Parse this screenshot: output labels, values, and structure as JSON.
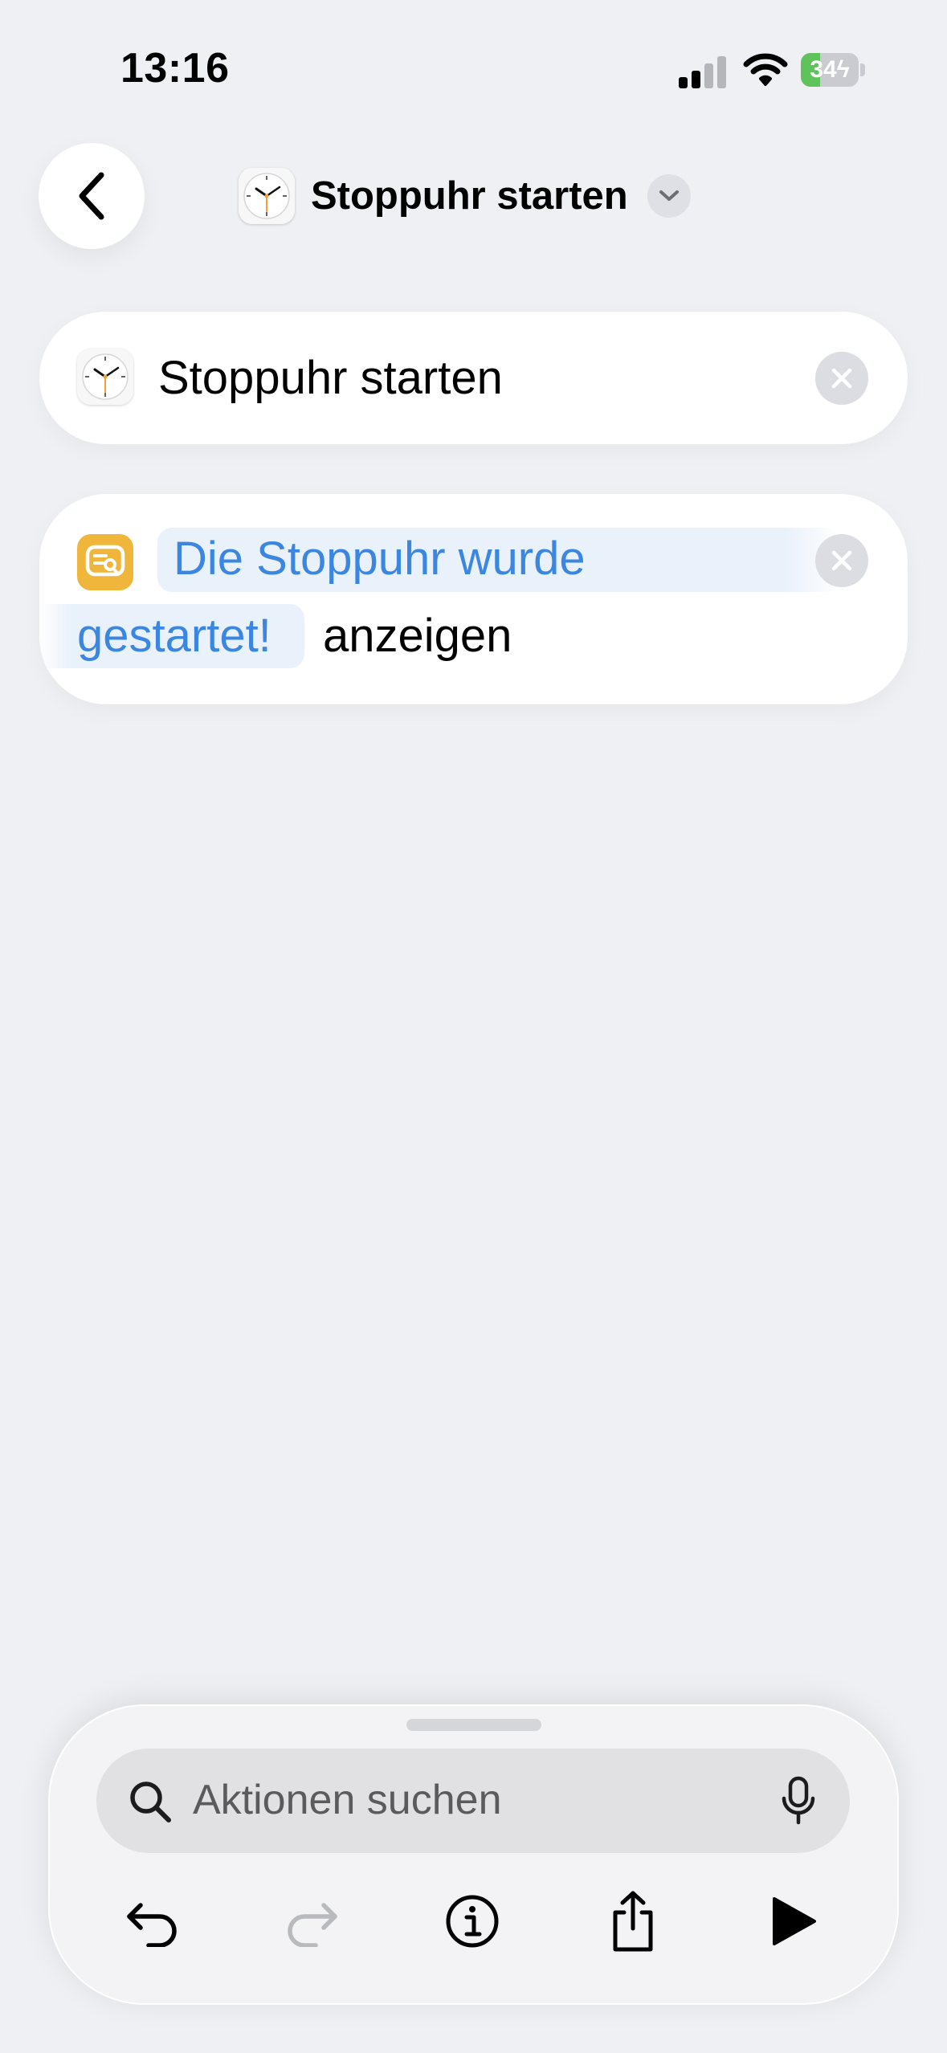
{
  "status_bar": {
    "time": "13:16",
    "battery_percent": "34",
    "battery_level": 0.34,
    "charging": true,
    "signal_bars_active": 2,
    "signal_bars_total": 4
  },
  "nav": {
    "title": "Stoppuhr starten",
    "back_icon": "chevron-left-icon",
    "app_icon": "clock-icon",
    "menu_icon": "chevron-down-icon"
  },
  "actions": [
    {
      "icon": "clock-icon",
      "title": "Stoppuhr starten"
    },
    {
      "icon": "show-result-icon",
      "variable_line1": "Die Stoppuhr wurde",
      "variable_line2": "gestartet!",
      "suffix": "anzeigen"
    }
  ],
  "bottom_sheet": {
    "search_placeholder": "Aktionen suchen",
    "toolbar": [
      "undo-icon",
      "redo-icon",
      "info-icon",
      "share-icon",
      "play-icon"
    ]
  },
  "colors": {
    "background": "#eff0f4",
    "accent_blue": "#3b86e0",
    "action_orange": "#f0b63c",
    "battery_green": "#5fc35c"
  }
}
